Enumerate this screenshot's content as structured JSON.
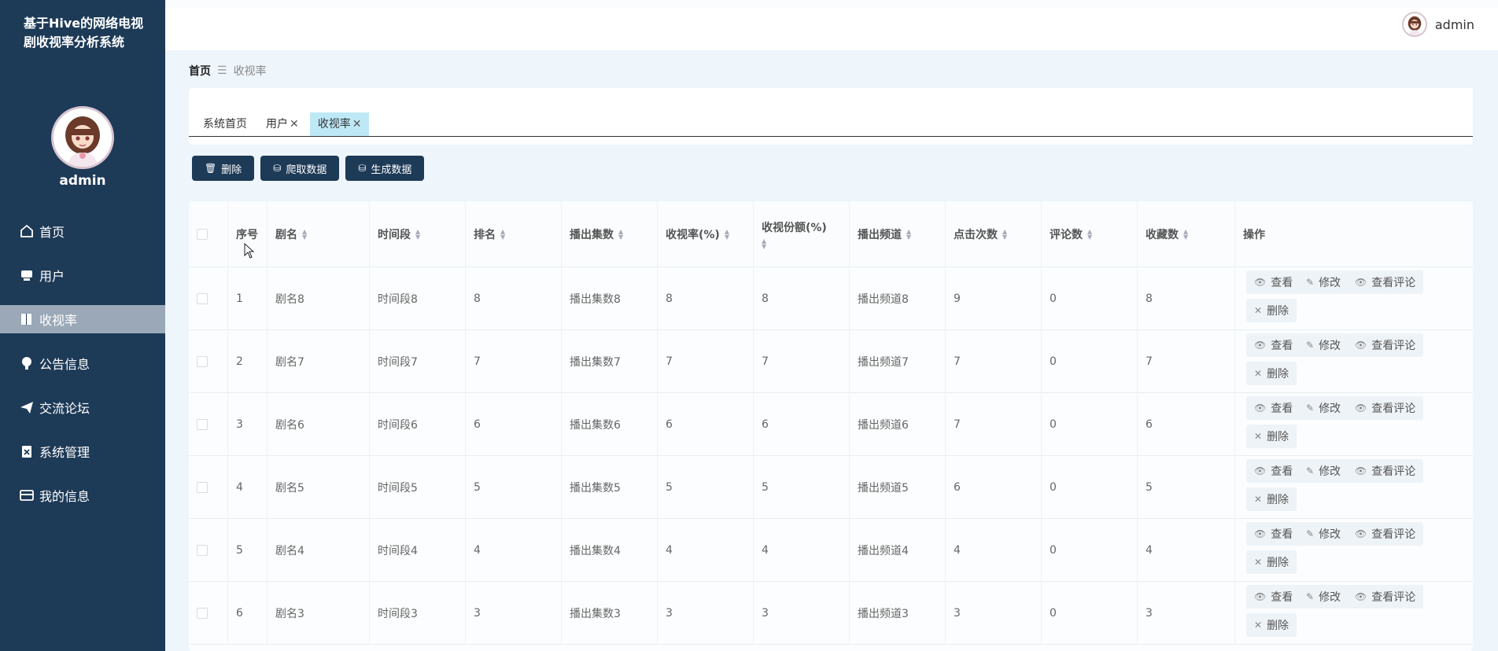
{
  "app": {
    "title": "基于Hive的网络电视剧收视率分析系统",
    "user": "admin"
  },
  "sidebar": {
    "items": [
      {
        "label": "首页",
        "icon": "home-icon"
      },
      {
        "label": "用户",
        "icon": "user-icon"
      },
      {
        "label": "收视率",
        "icon": "book-icon",
        "active": true
      },
      {
        "label": "公告信息",
        "icon": "bulb-icon"
      },
      {
        "label": "交流论坛",
        "icon": "send-icon"
      },
      {
        "label": "系统管理",
        "icon": "clipboard-icon"
      },
      {
        "label": "我的信息",
        "icon": "card-icon"
      }
    ]
  },
  "header": {
    "username": "admin"
  },
  "breadcrumb": {
    "home": "首页",
    "separator": "☰",
    "current": "收视率"
  },
  "tabs": [
    {
      "label": "系统首页",
      "closable": false
    },
    {
      "label": "用户",
      "closable": true
    },
    {
      "label": "收视率",
      "closable": true,
      "active": true
    }
  ],
  "toolbar": {
    "delete_label": "删除",
    "crawl_label": "爬取数据",
    "generate_label": "生成数据"
  },
  "table": {
    "columns": [
      "序号",
      "剧名",
      "时间段",
      "排名",
      "播出集数",
      "收视率(%)",
      "收视份额(%)",
      "播出频道",
      "点击次数",
      "评论数",
      "收藏数",
      "操作"
    ],
    "rows": [
      [
        "1",
        "剧名8",
        "时间段8",
        "8",
        "播出集数8",
        "8",
        "8",
        "播出频道8",
        "9",
        "0",
        "8"
      ],
      [
        "2",
        "剧名7",
        "时间段7",
        "7",
        "播出集数7",
        "7",
        "7",
        "播出频道7",
        "7",
        "0",
        "7"
      ],
      [
        "3",
        "剧名6",
        "时间段6",
        "6",
        "播出集数6",
        "6",
        "6",
        "播出频道6",
        "7",
        "0",
        "6"
      ],
      [
        "4",
        "剧名5",
        "时间段5",
        "5",
        "播出集数5",
        "5",
        "5",
        "播出频道5",
        "6",
        "0",
        "5"
      ],
      [
        "5",
        "剧名4",
        "时间段4",
        "4",
        "播出集数4",
        "4",
        "4",
        "播出频道4",
        "4",
        "0",
        "4"
      ],
      [
        "6",
        "剧名3",
        "时间段3",
        "3",
        "播出集数3",
        "3",
        "3",
        "播出频道3",
        "3",
        "0",
        "3"
      ]
    ],
    "ops": {
      "view": "查看",
      "edit": "修改",
      "comments": "查看评论",
      "delete": "删除"
    }
  }
}
